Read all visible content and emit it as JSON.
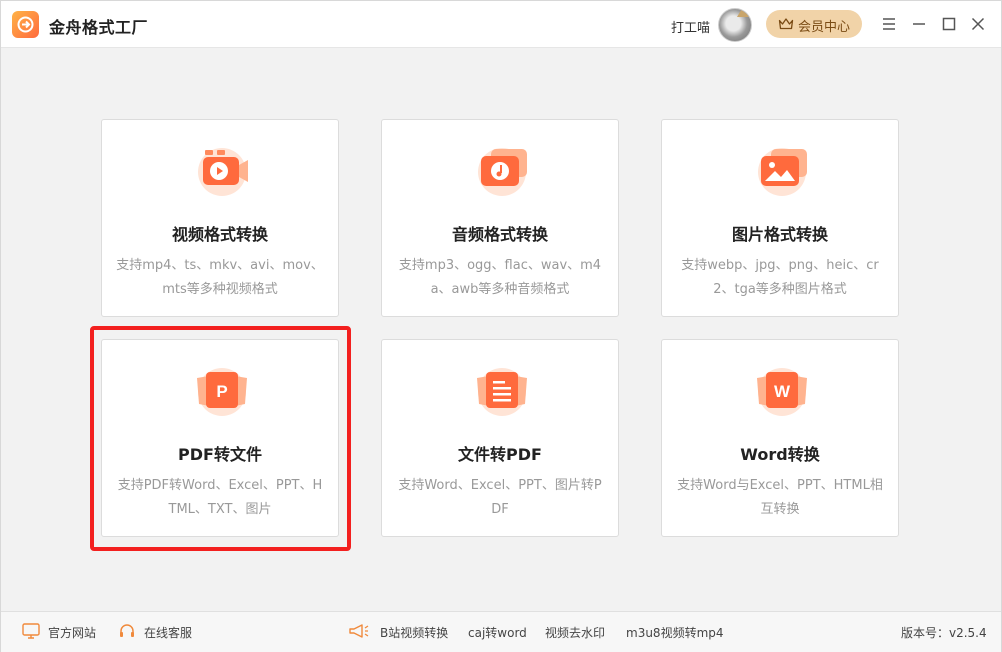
{
  "app": {
    "title": "金舟格式工厂"
  },
  "user": {
    "name": "打工喵"
  },
  "vip": {
    "label": "会员中心"
  },
  "cards": [
    {
      "title": "视频格式转换",
      "desc": "支持mp4、ts、mkv、avi、mov、mts等多种视频格式",
      "icon": "video-icon"
    },
    {
      "title": "音频格式转换",
      "desc": "支持mp3、ogg、flac、wav、m4a、awb等多种音频格式",
      "icon": "audio-icon"
    },
    {
      "title": "图片格式转换",
      "desc": "支持webp、jpg、png、heic、cr2、tga等多种图片格式",
      "icon": "image-icon"
    },
    {
      "title": "PDF转文件",
      "desc": "支持PDF转Word、Excel、PPT、HTML、TXT、图片",
      "icon": "pdf-icon",
      "icon_letter": "P",
      "selected": true
    },
    {
      "title": "文件转PDF",
      "desc": "支持Word、Excel、PPT、图片转PDF",
      "icon": "document-icon"
    },
    {
      "title": "Word转换",
      "desc": "支持Word与Excel、PPT、HTML相互转换",
      "icon": "word-icon",
      "icon_letter": "W"
    }
  ],
  "bottom": {
    "website": "官方网站",
    "support": "在线客服",
    "links": [
      "B站视频转换",
      "caj转word",
      "视频去水印",
      "m3u8视频转mp4"
    ],
    "version": "版本号：v2.5.4"
  },
  "colors": {
    "accent": "#ff6a3d",
    "accent_light": "#ffb38f",
    "highlight": "#f3201f",
    "vip_bg": "#f1d3a8"
  }
}
